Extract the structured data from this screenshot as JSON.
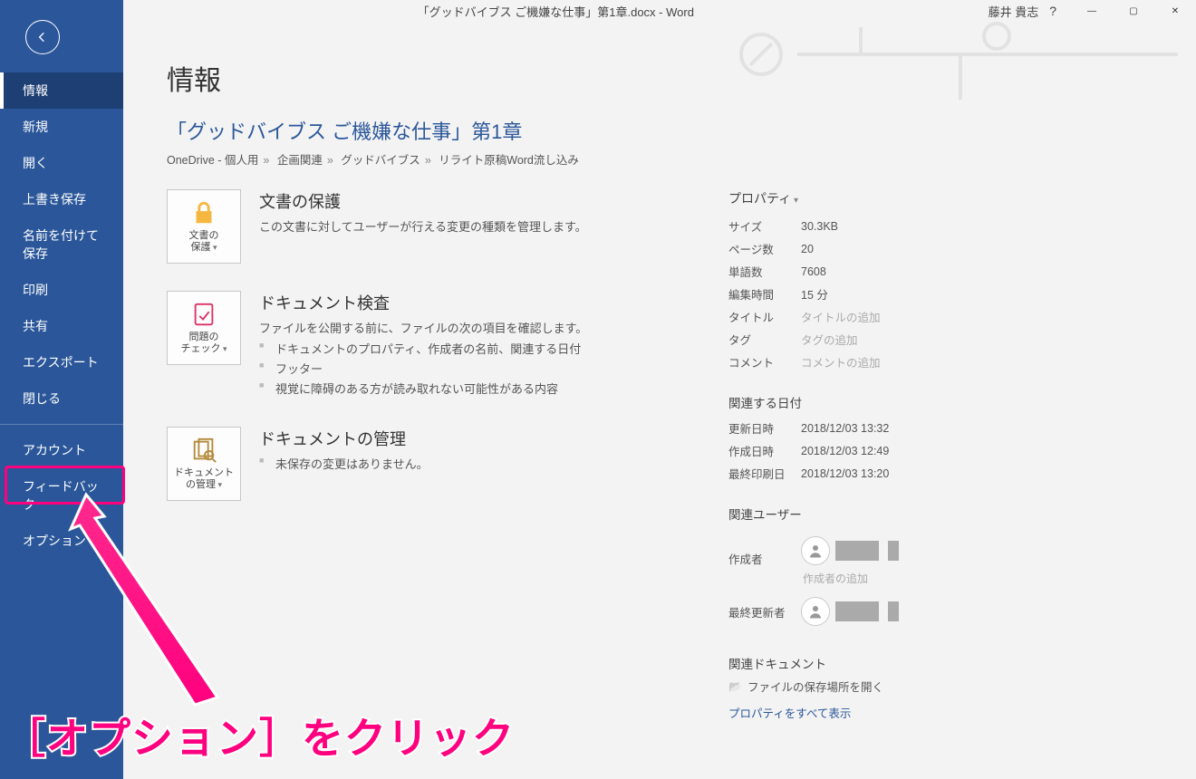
{
  "titlebar": {
    "doc_title": "「グッドバイブス  ご機嫌な仕事」第1章.docx  -  Word",
    "user_name": "藤井 貴志",
    "help_label": "?"
  },
  "sidebar": {
    "items": [
      {
        "key": "info",
        "label": "情報",
        "selected": true
      },
      {
        "key": "new",
        "label": "新規"
      },
      {
        "key": "open",
        "label": "開く"
      },
      {
        "key": "save",
        "label": "上書き保存"
      },
      {
        "key": "saveas",
        "label": "名前を付けて保存"
      },
      {
        "key": "print",
        "label": "印刷"
      },
      {
        "key": "share",
        "label": "共有"
      },
      {
        "key": "export",
        "label": "エクスポート"
      },
      {
        "key": "close",
        "label": "閉じる"
      }
    ],
    "footer": [
      {
        "key": "account",
        "label": "アカウント"
      },
      {
        "key": "feedback",
        "label": "フィードバック"
      },
      {
        "key": "options",
        "label": "オプション"
      }
    ]
  },
  "annotation": {
    "text": "［オプション］をクリック"
  },
  "main": {
    "heading": "情報",
    "doc_link_title": "「グッドバイブス  ご機嫌な仕事」第1章",
    "breadcrumb": [
      "OneDrive - 個人用",
      "企画関連",
      "グッドバイブス",
      "リライト原稿Word流し込み"
    ],
    "tiles": {
      "protect": {
        "button_line1": "文書の",
        "button_line2": "保護",
        "title": "文書の保護",
        "desc": "この文書に対してユーザーが行える変更の種類を管理します。"
      },
      "inspect": {
        "button_line1": "問題の",
        "button_line2": "チェック",
        "title": "ドキュメント検査",
        "desc": "ファイルを公開する前に、ファイルの次の項目を確認します。",
        "items": [
          "ドキュメントのプロパティ、作成者の名前、関連する日付",
          "フッター",
          "視覚に障碍のある方が読み取れない可能性がある内容"
        ]
      },
      "manage": {
        "button_line1": "ドキュメント",
        "button_line2": "の管理",
        "title": "ドキュメントの管理",
        "items": [
          "未保存の変更はありません。"
        ]
      }
    },
    "properties": {
      "header": "プロパティ",
      "rows": [
        {
          "k": "サイズ",
          "v": "30.3KB"
        },
        {
          "k": "ページ数",
          "v": "20"
        },
        {
          "k": "単語数",
          "v": "7608"
        },
        {
          "k": "編集時間",
          "v": "15 分"
        },
        {
          "k": "タイトル",
          "v": "タイトルの追加",
          "ph": true
        },
        {
          "k": "タグ",
          "v": "タグの追加",
          "ph": true
        },
        {
          "k": "コメント",
          "v": "コメントの追加",
          "ph": true
        }
      ],
      "dates_header": "関連する日付",
      "dates": [
        {
          "k": "更新日時",
          "v": "2018/12/03 13:32"
        },
        {
          "k": "作成日時",
          "v": "2018/12/03 12:49"
        },
        {
          "k": "最終印刷日",
          "v": "2018/12/03 13:20"
        }
      ],
      "users_header": "関連ユーザー",
      "author_label": "作成者",
      "add_author": "作成者の追加",
      "last_modified_label": "最終更新者",
      "docs_header": "関連ドキュメント",
      "open_location": "ファイルの保存場所を開く",
      "show_all": "プロパティをすべて表示"
    }
  }
}
